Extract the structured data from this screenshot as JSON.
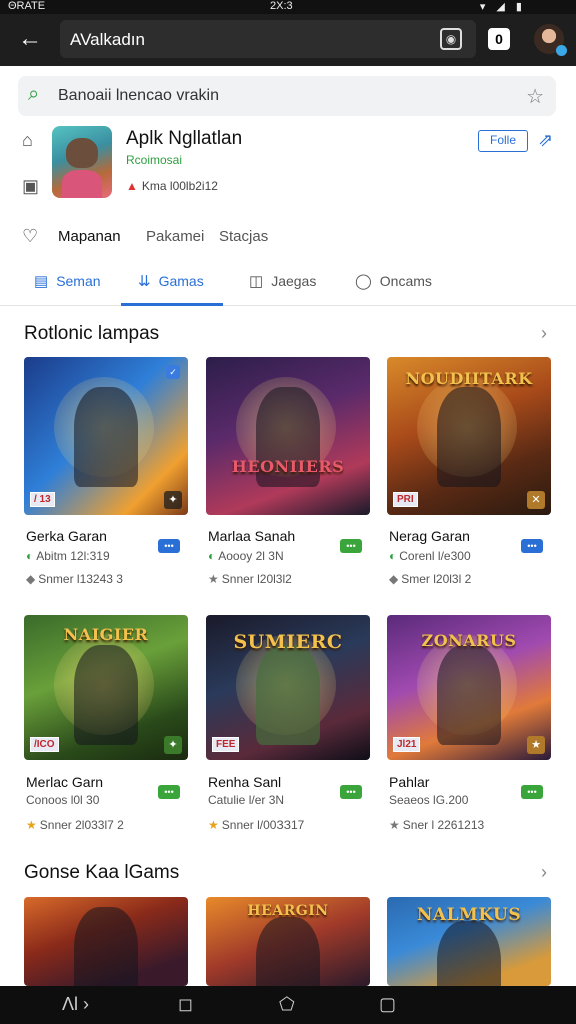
{
  "status_bar": {
    "left": "ΘRATE",
    "center": "2X:3",
    "right_icons": "▾ ◢ ▮"
  },
  "app_bar": {
    "back_icon": "arrow-left-icon",
    "url_text": "AValkadın",
    "tab_count": "0"
  },
  "search": {
    "value": "Banoaii lnencao vrakin"
  },
  "app": {
    "name": "Aplk Ngllatlan",
    "developer": "Rcoimosai",
    "meta": "Kma l00lb2i12",
    "follow_label": "Folle"
  },
  "chips": [
    "Mapanan",
    "Pakamei",
    "Stacjas"
  ],
  "tabs": [
    {
      "label": "Seman",
      "icon": "▤",
      "active": false
    },
    {
      "label": "Gamas",
      "icon": "⇊",
      "active": true
    },
    {
      "label": "Jaegas",
      "icon": "◫",
      "active": false
    },
    {
      "label": "Oncams",
      "icon": "◯",
      "active": false
    }
  ],
  "sections": [
    {
      "title": "Rotlonic lampas",
      "cards": [
        {
          "name": "Gerka Garan",
          "sub": "Abitm 12l:319",
          "rating": "Snmer l13243 3",
          "badge": "/ 13",
          "overlay": "",
          "pill_color": "#2a6fd6"
        },
        {
          "name": "Marlaa Sanah",
          "sub": "Aoooy 2l 3N",
          "rating": "Snner l20l3l2",
          "badge": "",
          "overlay": "HEONIIERS",
          "pill_color": "#3aa53a"
        },
        {
          "name": "Nerag Garan",
          "sub": "Corenl l/e300",
          "rating": "Smer l20l3l 2",
          "badge": "PRI",
          "overlay": "NOUDIITARK",
          "pill_color": "#2a6fd6"
        },
        {
          "name": "Merlac Garn",
          "sub": "Conoos l0l 30",
          "rating": "Snner 2l033l7 2",
          "badge": "/ICO",
          "overlay": "NAIGIER",
          "pill_color": "#3aa53a"
        },
        {
          "name": "Renha Sanl",
          "sub": "Catulie l/er 3N",
          "rating": "Snner l/00ЗЗ17",
          "badge": "FEE",
          "overlay": "SUMIERC",
          "pill_color": "#3aa53a"
        },
        {
          "name": "Pahlar",
          "sub": "Seaeos lG.200",
          "rating": "Sner l 2261213",
          "badge": "Jl21",
          "overlay": "ZONARUS",
          "pill_color": "#3aa53a"
        }
      ]
    },
    {
      "title": "Gonse Kaa lGams",
      "cards": []
    }
  ],
  "bottom_section_overlays": [
    "",
    "HEARGIN",
    "NALMKUS"
  ],
  "nav": {
    "back": "Λl ›",
    "home": "◻",
    "assistant": "⬠",
    "recents": "▢"
  }
}
